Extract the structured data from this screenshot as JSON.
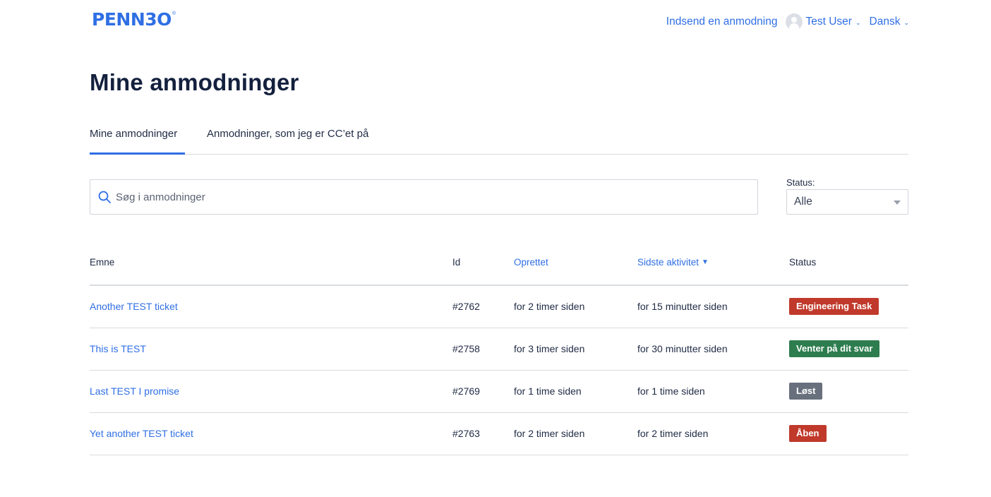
{
  "header": {
    "logo_text": "PENN3O",
    "logo_mark": "®",
    "submit_request": "Indsend en anmodning",
    "user_name": "Test User",
    "language": "Dansk"
  },
  "page": {
    "title": "Mine anmodninger"
  },
  "tabs": [
    {
      "label": "Mine anmodninger",
      "active": true
    },
    {
      "label": "Anmodninger, som jeg er CC’et på",
      "active": false
    }
  ],
  "search": {
    "placeholder": "Søg i anmodninger",
    "value": ""
  },
  "status_filter": {
    "label": "Status:",
    "selected": "Alle"
  },
  "table": {
    "columns": {
      "subject": "Emne",
      "id": "Id",
      "created": "Oprettet",
      "activity": "Sidste aktivitet",
      "status": "Status"
    },
    "sort_indicator": "▼",
    "rows": [
      {
        "subject": "Another TEST ticket",
        "id": "#2762",
        "created": "for 2 timer siden",
        "activity": "for 15 minutter siden",
        "status": "Engineering Task",
        "status_color": "#c0392b"
      },
      {
        "subject": "This is TEST",
        "id": "#2758",
        "created": "for 3 timer siden",
        "activity": "for 30 minutter siden",
        "status": "Venter på dit svar",
        "status_color": "#2e7d4f"
      },
      {
        "subject": "Last TEST I promise",
        "id": "#2769",
        "created": "for 1 time siden",
        "activity": "for 1 time siden",
        "status": "Løst",
        "status_color": "#68707d"
      },
      {
        "subject": "Yet another TEST ticket",
        "id": "#2763",
        "created": "for 2 timer siden",
        "activity": "for 2 timer siden",
        "status": "Åben",
        "status_color": "#c0392b"
      }
    ]
  },
  "colors": {
    "accent": "#2f6fe4",
    "title": "#13203d",
    "border": "#d8dbe0"
  }
}
